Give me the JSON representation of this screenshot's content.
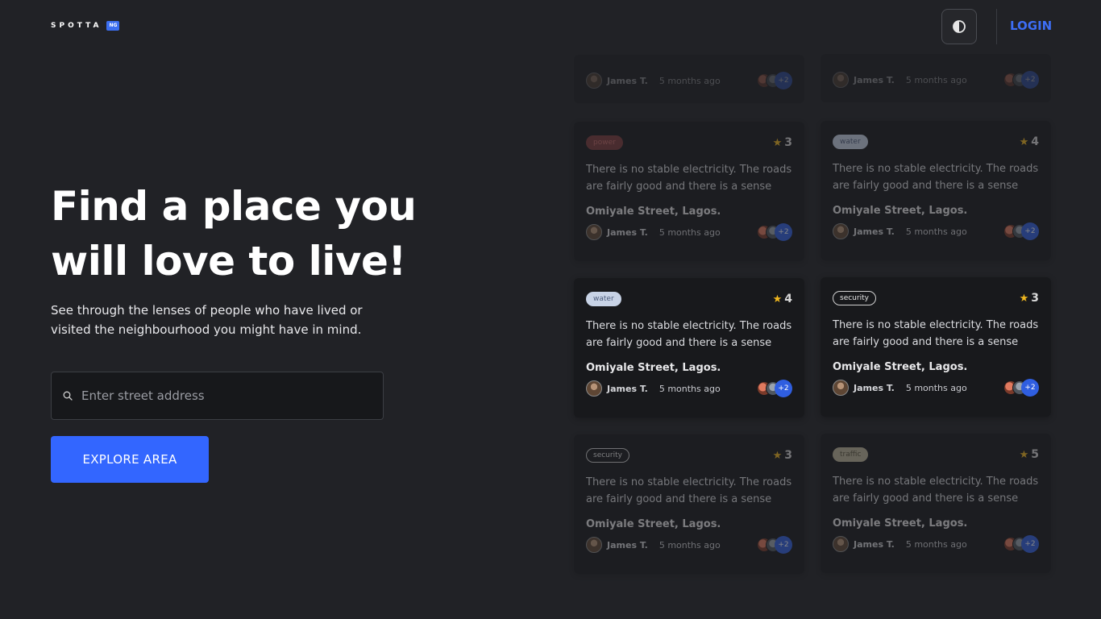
{
  "header": {
    "logo_text": "SPOTTA",
    "logo_badge": "NG",
    "theme_icon": "contrast-icon",
    "login_label": "LOGIN"
  },
  "hero": {
    "title": "Find a place you will love to live!",
    "subtitle": "See through the lenses of people who have lived or visited the neighbourhood you might have in mind.",
    "search_placeholder": "Enter street address",
    "search_icon": "search-icon",
    "explore_label": "EXPLORE AREA"
  },
  "colors": {
    "background": "#212226",
    "card": "#18191c",
    "accent": "#3366ff",
    "login": "#3d6ef5",
    "star": "#f1b81f"
  },
  "top_strips": [
    {
      "author": "James T.",
      "time": "5 months ago",
      "more": "+2"
    },
    {
      "author": "James T.",
      "time": "5 months ago",
      "more": "+2"
    }
  ],
  "reviews": [
    {
      "tag": "power",
      "rating": "3",
      "text": "There is no stable electricity. The roads are fairly good and there is a sense of…",
      "street": "Omiyale Street, Lagos.",
      "author": "James T.",
      "time": "5 months ago",
      "more": "+2"
    },
    {
      "tag": "water",
      "rating": "4",
      "text": "There is no stable electricity. The roads are fairly good and there is a sense of…",
      "street": "Omiyale Street, Lagos.",
      "author": "James T.",
      "time": "5 months ago",
      "more": "+2"
    },
    {
      "tag": "water",
      "rating": "4",
      "text": "There is no stable electricity. The roads are fairly good and there is a sense of…",
      "street": "Omiyale Street, Lagos.",
      "author": "James T.",
      "time": "5 months ago",
      "more": "+2"
    },
    {
      "tag": "security",
      "rating": "3",
      "text": "There is no stable electricity. The roads are fairly good and there is a sense of…",
      "street": "Omiyale Street, Lagos.",
      "author": "James T.",
      "time": "5 months ago",
      "more": "+2"
    },
    {
      "tag": "security",
      "rating": "3",
      "text": "There is no stable electricity. The roads are fairly good and there is a sense of…",
      "street": "Omiyale Street, Lagos.",
      "author": "James T.",
      "time": "5 months ago",
      "more": "+2"
    },
    {
      "tag": "traffic",
      "rating": "5",
      "text": "There is no stable electricity. The roads are fairly good and there is a sense of…",
      "street": "Omiyale Street, Lagos.",
      "author": "James T.",
      "time": "5 months ago",
      "more": "+2"
    }
  ]
}
